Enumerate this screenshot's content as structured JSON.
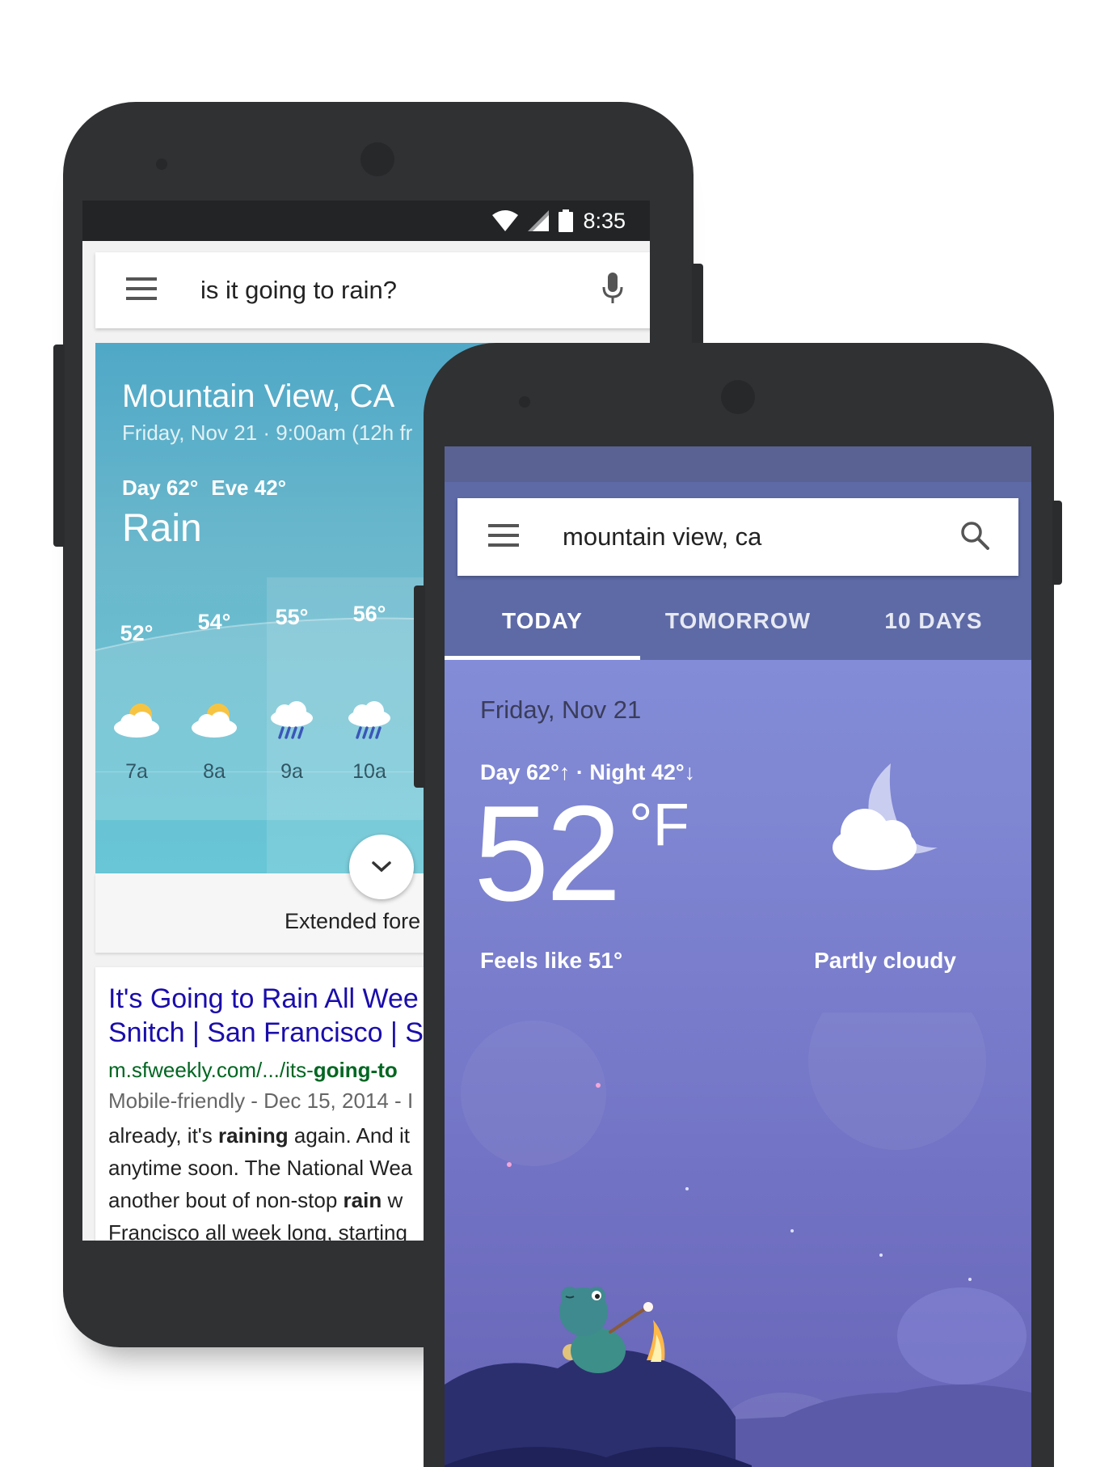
{
  "phone1": {
    "status_bar": {
      "time": "8:35"
    },
    "search": {
      "query": "is it going to rain?"
    },
    "weather": {
      "location": "Mountain View, CA",
      "date_line": "Friday, Nov 21 · 9:00am (12h fr",
      "day_temp": "Day 62°",
      "eve_temp": "Eve 42°",
      "condition": "Rain",
      "hourly": [
        {
          "temp": "52°",
          "time": "7a",
          "icon": "partly-sunny-icon"
        },
        {
          "temp": "54°",
          "time": "8a",
          "icon": "partly-sunny-icon"
        },
        {
          "temp": "55°",
          "time": "9a",
          "icon": "rain-cloud-icon"
        },
        {
          "temp": "56°",
          "time": "10a",
          "icon": "rain-cloud-icon"
        }
      ],
      "extended_label": "Extended fore"
    },
    "result": {
      "title_line1": "It's Going to Rain All Wee",
      "title_line2": "Snitch | San Francisco | S",
      "url_prefix": "m.sfweekly.com/.../its-",
      "url_bold": "going-to",
      "meta": "Mobile-friendly - Dec 15, 2014 - I",
      "snippet": [
        {
          "pre": "already, it's ",
          "bold": "raining",
          "post": " again. And it"
        },
        {
          "pre": "anytime soon. The National Wea",
          "bold": "",
          "post": ""
        },
        {
          "pre": "another bout of non-stop ",
          "bold": "rain",
          "post": " w"
        },
        {
          "pre": "Francisco all week long, starting",
          "bold": "",
          "post": ""
        }
      ]
    }
  },
  "phone2": {
    "search": {
      "query": "mountain view, ca"
    },
    "tabs": [
      {
        "label": "TODAY",
        "active": true
      },
      {
        "label": "TOMORROW",
        "active": false
      },
      {
        "label": "10 DAYS",
        "active": false
      }
    ],
    "weather": {
      "date": "Friday, Nov 21",
      "day_night": "Day 62°↑ · Night 42°↓",
      "temperature": "52",
      "unit": "°F",
      "feels_like": "Feels like 51°",
      "condition": "Partly cloudy",
      "icon": "moon-cloud-icon"
    }
  },
  "colors": {
    "card_teal": "#5fb4cb",
    "night_purple": "#7f86d2",
    "link_blue": "#1a0dab",
    "url_green": "#006621",
    "phone_body": "#2f3133"
  }
}
